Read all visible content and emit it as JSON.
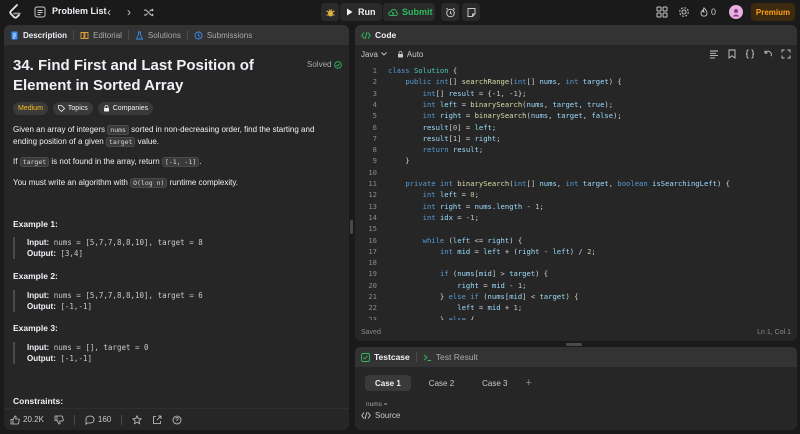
{
  "topbar": {
    "problem_list_label": "Problem List",
    "run_label": "Run",
    "submit_label": "Submit",
    "streak_count": "0",
    "premium_label": "Premium"
  },
  "left_tabs": [
    {
      "label": "Description"
    },
    {
      "label": "Editorial"
    },
    {
      "label": "Solutions"
    },
    {
      "label": "Submissions"
    }
  ],
  "problem": {
    "title": "34. Find First and Last Position of Element in Sorted Array",
    "status": "Solved",
    "difficulty": "Medium",
    "topics_label": "Topics",
    "companies_label": "Companies",
    "desc1_pre": "Given an array of integers ",
    "desc1_code1": "nums",
    "desc1_mid": " sorted in non-decreasing order, find the starting and ending position of a given ",
    "desc1_code2": "target",
    "desc1_post": " value.",
    "desc2_pre": "If ",
    "desc2_code1": "target",
    "desc2_mid": " is not found in the array, return ",
    "desc2_code2": "[-1, -1]",
    "desc2_post": ".",
    "desc3_pre": "You must write an algorithm with ",
    "desc3_code": "O(log n)",
    "desc3_post": " runtime complexity.",
    "examples": [
      {
        "title": "Example 1:",
        "input": "nums = [5,7,7,8,8,10], target = 8",
        "output": "[3,4]"
      },
      {
        "title": "Example 2:",
        "input": "nums = [5,7,7,8,8,10], target = 6",
        "output": "[-1,-1]"
      },
      {
        "title": "Example 3:",
        "input": "nums = [], target = 0",
        "output": "[-1,-1]"
      }
    ],
    "input_label": "Input:",
    "output_label": "Output:",
    "constraints_label": "Constraints:"
  },
  "footer": {
    "likes": "20.2K",
    "comments": "160"
  },
  "code": {
    "tab_label": "Code",
    "language": "Java",
    "auto_label": "Auto",
    "saved_label": "Saved",
    "cursor_pos": "Ln 1, Col 1",
    "lines": [
      {
        "n": "1",
        "t": "class Solution {"
      },
      {
        "n": "2",
        "t": "    public int[] searchRange(int[] nums, int target) {"
      },
      {
        "n": "3",
        "t": "        int[] result = {-1, -1};"
      },
      {
        "n": "4",
        "t": "        int left = binarySearch(nums, target, true);"
      },
      {
        "n": "5",
        "t": "        int right = binarySearch(nums, target, false);"
      },
      {
        "n": "6",
        "t": "        result[0] = left;"
      },
      {
        "n": "7",
        "t": "        result[1] = right;"
      },
      {
        "n": "8",
        "t": "        return result;"
      },
      {
        "n": "9",
        "t": "    }"
      },
      {
        "n": "10",
        "t": ""
      },
      {
        "n": "11",
        "t": "    private int binarySearch(int[] nums, int target, boolean isSearchingLeft) {"
      },
      {
        "n": "12",
        "t": "        int left = 0;"
      },
      {
        "n": "13",
        "t": "        int right = nums.length - 1;"
      },
      {
        "n": "14",
        "t": "        int idx = -1;"
      },
      {
        "n": "15",
        "t": ""
      },
      {
        "n": "16",
        "t": "        while (left <= right) {"
      },
      {
        "n": "17",
        "t": "            int mid = left + (right - left) / 2;"
      },
      {
        "n": "18",
        "t": ""
      },
      {
        "n": "19",
        "t": "            if (nums[mid] > target) {"
      },
      {
        "n": "20",
        "t": "                right = mid - 1;"
      },
      {
        "n": "21",
        "t": "            } else if (nums[mid] < target) {"
      },
      {
        "n": "22",
        "t": "                left = mid + 1;"
      },
      {
        "n": "23",
        "t": "            } else {"
      }
    ]
  },
  "testpanel": {
    "testcase_label": "Testcase",
    "result_label": "Test Result",
    "cases": [
      "Case 1",
      "Case 2",
      "Case 3"
    ],
    "add_label": "+",
    "nums_label": "nums =",
    "source_label": "Source"
  },
  "colors": {
    "accent": "#ffa116",
    "success": "#2cbb5d",
    "medium": "#ffc01e",
    "keyword": "#569cd6"
  }
}
